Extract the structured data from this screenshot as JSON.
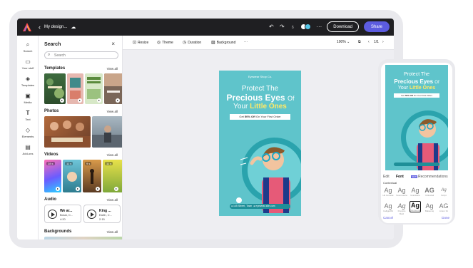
{
  "topbar": {
    "back_icon": "chevron-left",
    "doc_name": "My design...",
    "cloud_icon": "cloud-icon",
    "undo": "↶",
    "redo": "↷",
    "download_label": "Download",
    "share_label": "Share",
    "more": "···"
  },
  "rail": {
    "items": [
      {
        "icon": "⌕",
        "label": "Search"
      },
      {
        "icon": "▭",
        "label": "Your stuff"
      },
      {
        "icon": "◈",
        "label": "Templates"
      },
      {
        "icon": "▣",
        "label": "Media"
      },
      {
        "icon": "T",
        "label": "Text"
      },
      {
        "icon": "◇",
        "label": "Elements"
      },
      {
        "icon": "▤",
        "label": "Add-ons"
      }
    ]
  },
  "panel": {
    "title": "Search",
    "close": "×",
    "search_placeholder": "Search",
    "view_all": "View all",
    "sections": {
      "templates": "Templates",
      "photos": "Photos",
      "videos": "Videos",
      "audio": "Audio",
      "backgrounds": "Backgrounds"
    },
    "videos": [
      "28 s",
      "11 s",
      "9 s",
      "11 s"
    ],
    "audio": [
      {
        "title": "We ar...",
        "artist": "Bossi, C...",
        "duration": "4:20"
      },
      {
        "title": "King ...",
        "artist": "Earth, C...",
        "duration": "2:15"
      }
    ]
  },
  "toolbar": {
    "resize": "Resize",
    "theme": "Theme",
    "duration": "Duration",
    "background": "Background",
    "more": "···",
    "zoom": "100%",
    "page": "1/1"
  },
  "poster": {
    "brand": "Eyewear Shop Co.",
    "line1": "Protect The",
    "line2": "Precious Eyes",
    "line2b": "Of",
    "line3a": "Your",
    "line3b": "Little Ones",
    "offer_pre": "Get",
    "offer_bold": "50% Off",
    "offer_post": "On Your First Order",
    "contact1": "145 Street, Town",
    "contact2": "eyewear-site.com"
  },
  "phone": {
    "tabs": [
      "Edit",
      "Font",
      "Recommendations"
    ],
    "new_badge": "NEW",
    "section": "Contextual",
    "fonts_row1": [
      {
        "glyph": "Ag",
        "label": "Hk Grotesk"
      },
      {
        "glyph": "Ag",
        "label": "Sourcesans"
      },
      {
        "glyph": "Ag",
        "label": "Gravisans"
      },
      {
        "glyph": "AG",
        "label": "Yellowtail"
      },
      {
        "glyph": "Ag",
        "label": "Script"
      }
    ],
    "fonts_row2": [
      {
        "glyph": "Ag",
        "label": "Calligraffiti"
      },
      {
        "glyph": "Ag",
        "label": "Poppins Bold"
      },
      {
        "glyph": "Ag",
        "label": "Montserrat"
      },
      {
        "glyph": "Ag",
        "label": "Balsamiq"
      },
      {
        "glyph": "AG",
        "label": "Anton Sc"
      }
    ],
    "cancel": "Cancel",
    "done": "Done"
  },
  "colors": {
    "accent": "#5c5ce0",
    "poster_teal": "#5fc4cb",
    "poster_dark": "#2aa3ad",
    "topbar": "#1f1f22"
  }
}
